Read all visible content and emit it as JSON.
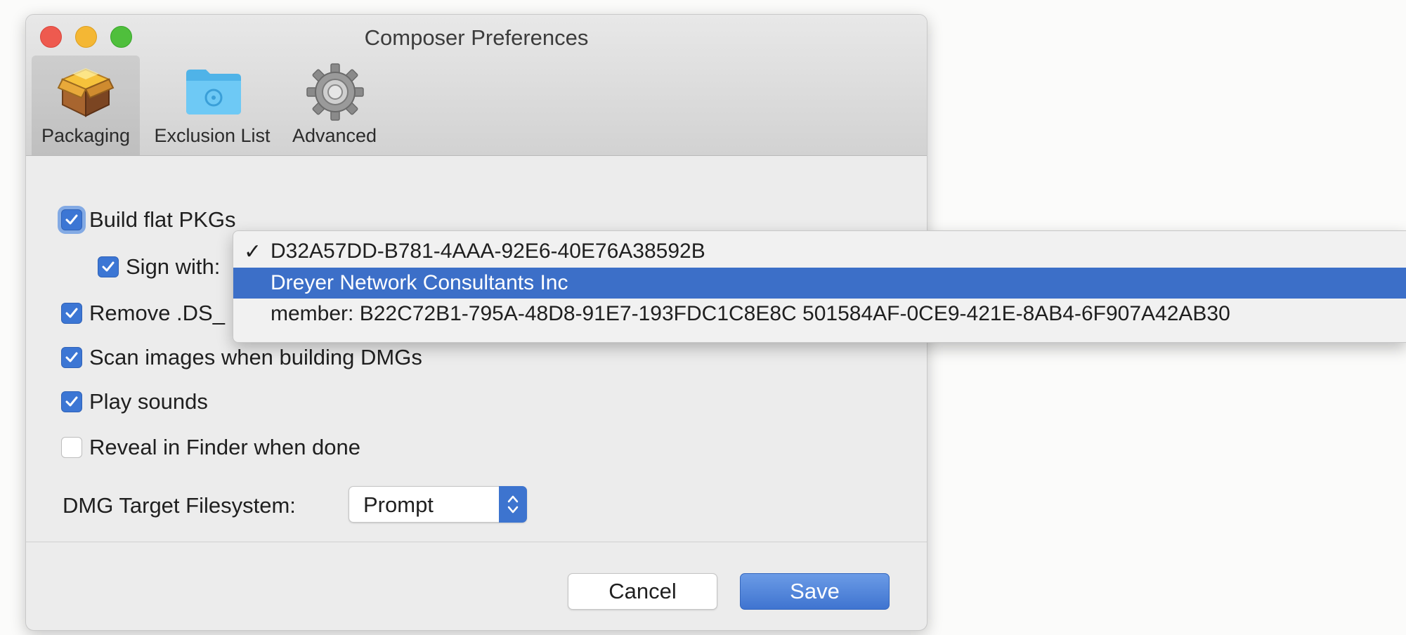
{
  "window": {
    "title": "Composer Preferences"
  },
  "toolbar": {
    "items": [
      {
        "label": "Packaging",
        "icon": "package-box-icon",
        "selected": true
      },
      {
        "label": "Exclusion List",
        "icon": "folder-icon",
        "selected": false
      },
      {
        "label": "Advanced",
        "icon": "gear-icon",
        "selected": false
      }
    ]
  },
  "packaging": {
    "build_flat": {
      "label": "Build flat PKGs",
      "checked": true
    },
    "sign_with": {
      "label": "Sign with:",
      "checked": true
    },
    "remove_ds": {
      "label": "Remove .DS_",
      "checked": true
    },
    "scan_images": {
      "label": "Scan images when building DMGs",
      "checked": true
    },
    "play_sounds": {
      "label": "Play sounds",
      "checked": true
    },
    "reveal_finder": {
      "label": "Reveal in Finder when done",
      "checked": false
    },
    "dmg_target": {
      "label": "DMG Target Filesystem:",
      "value": "Prompt"
    }
  },
  "buttons": {
    "cancel": "Cancel",
    "save": "Save"
  },
  "sign_menu": {
    "check_glyph": "✓",
    "items": [
      {
        "label": "D32A57DD-B781-4AAA-92E6-40E76A38592B",
        "checked": true,
        "highlighted": false
      },
      {
        "label": "Dreyer Network Consultants Inc",
        "checked": false,
        "highlighted": true
      },
      {
        "label": "member: B22C72B1-795A-48D8-91E7-193FDC1C8E8C 501584AF-0CE9-421E-8AB4-6F907A42AB30",
        "checked": false,
        "highlighted": false
      }
    ]
  },
  "colors": {
    "accent": "#3c76d4",
    "menu_highlight": "#3c6fc8"
  }
}
